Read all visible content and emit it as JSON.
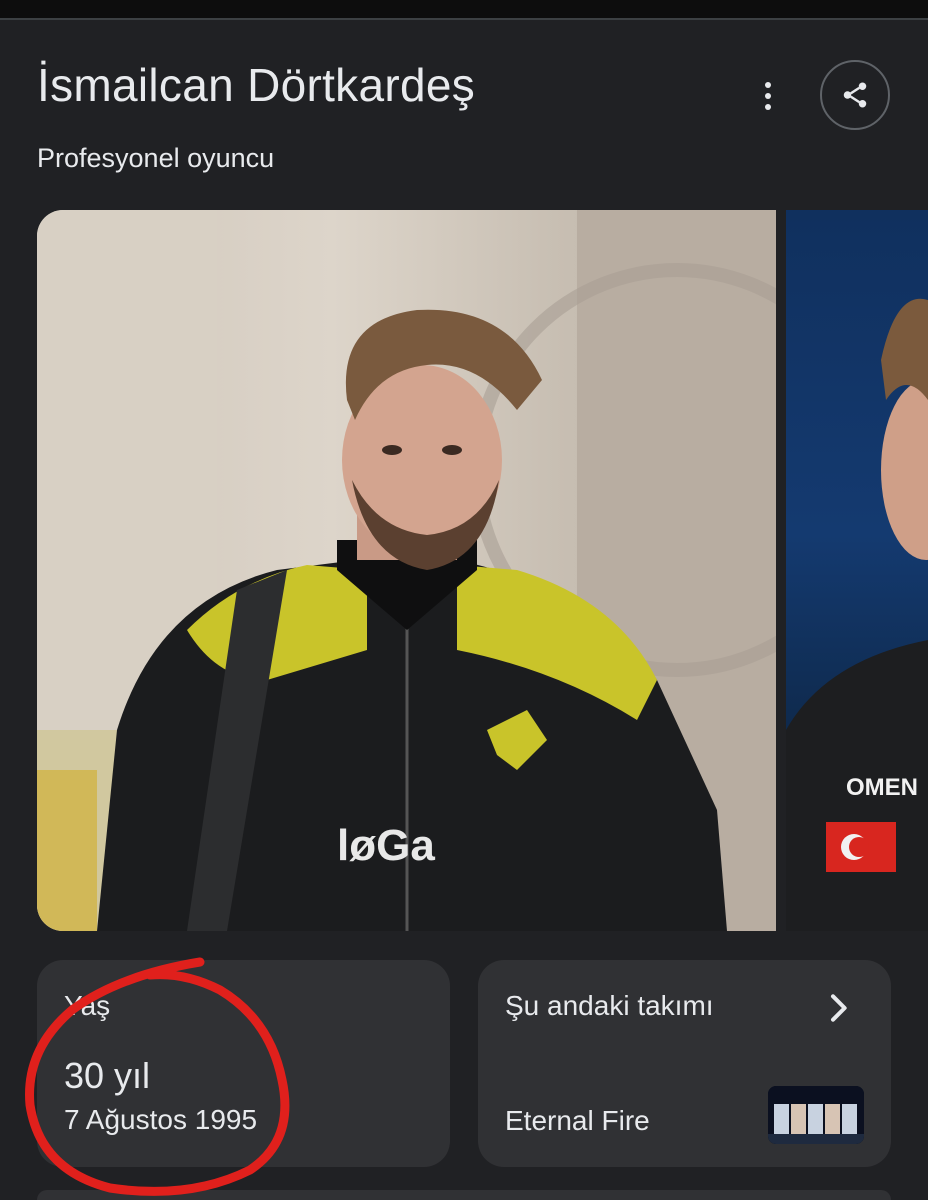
{
  "header": {
    "title": "İsmailcan Dörtkardeş",
    "subtitle": "Profesyonel oyuncu",
    "more_icon": "more-vert-icon",
    "share_icon": "share-icon"
  },
  "images": {
    "main_alt": "Portrait photo of player",
    "side_alt": "Second photo of player"
  },
  "facts": {
    "age": {
      "label": "Yaş",
      "value": "30 yıl",
      "birth_date": "7 Ağustos 1995"
    },
    "team": {
      "label": "Şu andaki takımı",
      "value": "Eternal Fire",
      "chevron_icon": "chevron-right-icon"
    }
  },
  "colors": {
    "background": "#202124",
    "card": "#303134",
    "text": "#e8eaed",
    "annotation_red": "#e0201c",
    "jacket_yellow": "#c9c42a"
  }
}
